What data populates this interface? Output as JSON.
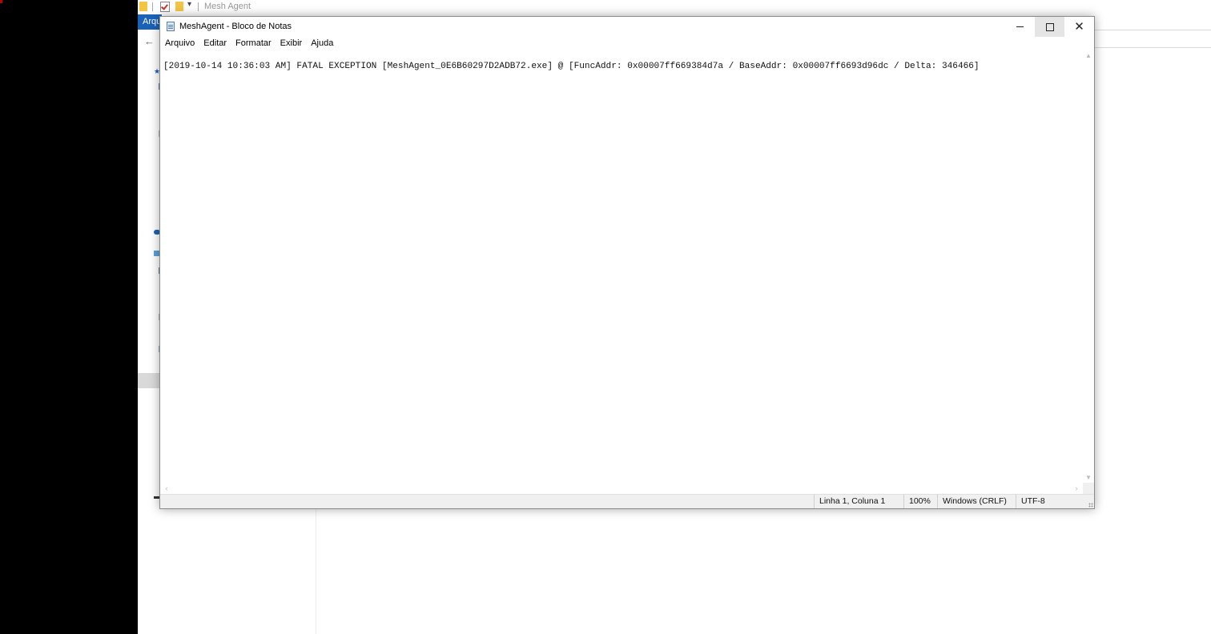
{
  "explorer": {
    "qat_title": "Mesh Agent",
    "ribbon_tab": "Arquivo",
    "back_arrow": "←",
    "qat_dropdown": "▾"
  },
  "notepad": {
    "title": "MeshAgent - Bloco de Notas",
    "menu": [
      "Arquivo",
      "Editar",
      "Formatar",
      "Exibir",
      "Ajuda"
    ],
    "content": "[2019-10-14 10:36:03 AM] FATAL EXCEPTION [MeshAgent_0E6B60297D2ADB72.exe] @ [FuncAddr: 0x00007ff669384d7a / BaseAddr: 0x00007ff6693d96dc / Delta: 346466]",
    "window_buttons": {
      "close_glyph": "✕"
    },
    "status": {
      "position": "Linha 1, Coluna 1",
      "zoom": "100%",
      "line_endings": "Windows (CRLF)",
      "encoding": "UTF-8"
    }
  },
  "icons": {
    "scroll_up": "▲",
    "scroll_down": "▼",
    "scroll_left": "‹",
    "scroll_right": "›"
  }
}
